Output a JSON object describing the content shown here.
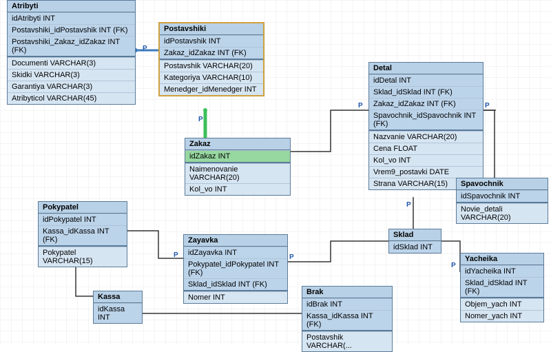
{
  "entities": {
    "Atribyti": {
      "title": "Atribyti",
      "rows": [
        {
          "text": "idAtribyti INT",
          "pk": true
        },
        {
          "text": "Postavshiki_idPostavshik INT (FK)",
          "pk": true
        },
        {
          "text": "Postavshiki_Zakaz_idZakaz INT (FK)",
          "pk": true
        },
        {
          "sep": true
        },
        {
          "text": "Documenti VARCHAR(3)"
        },
        {
          "text": "Skidki VARCHAR(3)"
        },
        {
          "text": "Garantiya VARCHAR(3)"
        },
        {
          "text": "Atribyticol VARCHAR(45)"
        }
      ]
    },
    "Postavshiki": {
      "title": "Postavshiki",
      "rows": [
        {
          "text": "idPostavshik INT",
          "pk": true
        },
        {
          "text": "Zakaz_idZakaz INT (FK)",
          "pk": true
        },
        {
          "sep": true
        },
        {
          "text": "Postavshik VARCHAR(20)"
        },
        {
          "text": "Kategoriya VARCHAR(10)"
        },
        {
          "text": "Menedger_idMenedger INT"
        }
      ]
    },
    "Zakaz": {
      "title": "Zakaz",
      "rows": [
        {
          "text": "idZakaz INT",
          "pk": true
        },
        {
          "sep": true
        },
        {
          "text": "Naimenovanie VARCHAR(20)"
        },
        {
          "text": "Kol_vo INT"
        }
      ]
    },
    "Detal": {
      "title": "Detal",
      "rows": [
        {
          "text": "idDetal INT",
          "pk": true
        },
        {
          "text": "Sklad_idSklad INT (FK)",
          "pk": true
        },
        {
          "text": "Zakaz_idZakaz INT (FK)",
          "pk": true
        },
        {
          "text": "Spavochnik_idSpavochnik INT (FK)",
          "pk": true
        },
        {
          "sep": true
        },
        {
          "text": "Nazvanie VARCHAR(20)"
        },
        {
          "text": "Cena FLOAT"
        },
        {
          "text": "Kol_vo INT"
        },
        {
          "text": "Vrem9_postavki DATE"
        },
        {
          "text": "Strana VARCHAR(15)"
        }
      ]
    },
    "Spavochnik": {
      "title": "Spavochnik",
      "rows": [
        {
          "text": "idSpavochnik INT",
          "pk": true
        },
        {
          "sep": true
        },
        {
          "text": "Novie_detali VARCHAR(20)"
        }
      ]
    },
    "Pokypatel": {
      "title": "Pokypatel",
      "rows": [
        {
          "text": "idPokypatel INT",
          "pk": true
        },
        {
          "text": "Kassa_idKassa INT (FK)",
          "pk": true
        },
        {
          "sep": true
        },
        {
          "text": "Pokypatel VARCHAR(15)"
        }
      ]
    },
    "Zayavka": {
      "title": "Zayavka",
      "rows": [
        {
          "text": "idZayavka INT",
          "pk": true
        },
        {
          "text": "Pokypatel_idPokypatel INT (FK)",
          "pk": true
        },
        {
          "text": "Sklad_idSklad INT (FK)",
          "pk": true
        },
        {
          "sep": true
        },
        {
          "text": "Nomer INT"
        }
      ]
    },
    "Sklad": {
      "title": "Sklad",
      "rows": [
        {
          "text": "idSklad INT",
          "pk": true
        }
      ]
    },
    "Yacheika": {
      "title": "Yacheika",
      "rows": [
        {
          "text": "idYacheika INT",
          "pk": true
        },
        {
          "text": "Sklad_idSklad INT (FK)",
          "pk": true
        },
        {
          "sep": true
        },
        {
          "text": "Objem_yach INT"
        },
        {
          "text": "Nomer_yach INT"
        }
      ]
    },
    "Kassa": {
      "title": "Kassa",
      "rows": [
        {
          "text": "idKassa INT",
          "pk": true
        }
      ]
    },
    "Brak": {
      "title": "Brak",
      "rows": [
        {
          "text": "idBrak INT",
          "pk": true
        },
        {
          "text": "Kassa_idKassa INT (FK)",
          "pk": true
        },
        {
          "sep": true
        },
        {
          "text": "Postavshik VARCHAR(..."
        }
      ]
    }
  },
  "relations": [
    {
      "from": "Atribyti",
      "to": "Postavshiki",
      "type": "identifying"
    },
    {
      "from": "Postavshiki",
      "to": "Zakaz",
      "type": "identifying"
    },
    {
      "from": "Detal",
      "to": "Zakaz",
      "type": "identifying"
    },
    {
      "from": "Detal",
      "to": "Sklad",
      "type": "identifying"
    },
    {
      "from": "Detal",
      "to": "Spavochnik",
      "type": "identifying"
    },
    {
      "from": "Zayavka",
      "to": "Pokypatel",
      "type": "identifying"
    },
    {
      "from": "Zayavka",
      "to": "Sklad",
      "type": "identifying"
    },
    {
      "from": "Yacheika",
      "to": "Sklad",
      "type": "identifying"
    },
    {
      "from": "Pokypatel",
      "to": "Kassa",
      "type": "identifying"
    },
    {
      "from": "Brak",
      "to": "Kassa",
      "type": "identifying"
    }
  ]
}
